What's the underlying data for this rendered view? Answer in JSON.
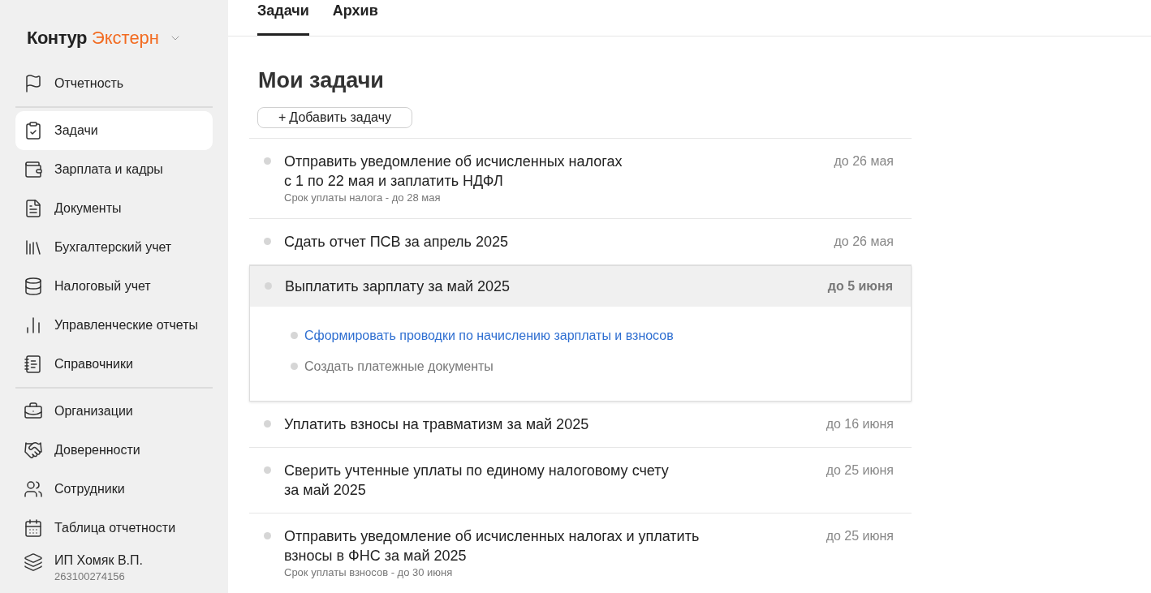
{
  "sidebar": {
    "logo": {
      "brand": "Контур",
      "product": "Экстерн"
    },
    "sections": [
      [
        {
          "label": "Отчетность",
          "selected": false
        }
      ],
      [
        {
          "label": "Задачи",
          "selected": true
        },
        {
          "label": "Зарплата и кадры",
          "selected": false
        },
        {
          "label": "Документы",
          "selected": false
        },
        {
          "label": "Бухгалтерский учет",
          "selected": false
        },
        {
          "label": "Налоговый учет",
          "selected": false
        },
        {
          "label": "Управленческие отчеты",
          "selected": false
        },
        {
          "label": "Справочники",
          "selected": false
        }
      ],
      [
        {
          "label": "Организации",
          "selected": false
        },
        {
          "label": "Доверенности",
          "selected": false
        },
        {
          "label": "Сотрудники",
          "selected": false
        },
        {
          "label": "Таблица отчетности",
          "selected": false
        }
      ]
    ],
    "account": {
      "name": "ИП Хомяк В.П.",
      "inn": "263100274156"
    }
  },
  "tabs": [
    {
      "label": "Задачи",
      "selected": true
    },
    {
      "label": "Архив",
      "selected": false
    }
  ],
  "heading": "Мои задачи",
  "add_button": {
    "icon": "+",
    "label": "Добавить задачу"
  },
  "tasks": [
    {
      "title_lines": [
        "Отправить уведомление об исчисленных налогах",
        "с 1 по 22 мая и заплатить НДФЛ"
      ],
      "note": "Срок уплаты налога - до 28 мая",
      "due": "до 26 мая",
      "expanded": false
    },
    {
      "title_lines": [
        "Сдать отчет ПСВ за апрель 2025"
      ],
      "due": "до 26 мая",
      "expanded": false
    },
    {
      "title_lines": [
        "Выплатить зарплату за май 2025"
      ],
      "due": "до 5 июня",
      "expanded": true,
      "subtasks": [
        {
          "label": "Сформировать проводки по начислению зарплаты и взносов",
          "kind": "link"
        },
        {
          "label": "Создать платежные документы",
          "kind": "plain"
        }
      ]
    },
    {
      "title_lines": [
        "Уплатить взносы на травматизм за май 2025"
      ],
      "due": "до 16 июня",
      "expanded": false
    },
    {
      "title_lines": [
        "Сверить учтенные уплаты по единому налоговому счету",
        "за май 2025"
      ],
      "due": "до 25 июня",
      "expanded": false
    },
    {
      "title_lines": [
        "Отправить уведомление об исчисленных налогах и уплатить",
        "взносы в ФНС за май 2025"
      ],
      "note": "Срок уплаты взносов - до 30 июня",
      "due": "до 25 июня",
      "expanded": false
    }
  ]
}
